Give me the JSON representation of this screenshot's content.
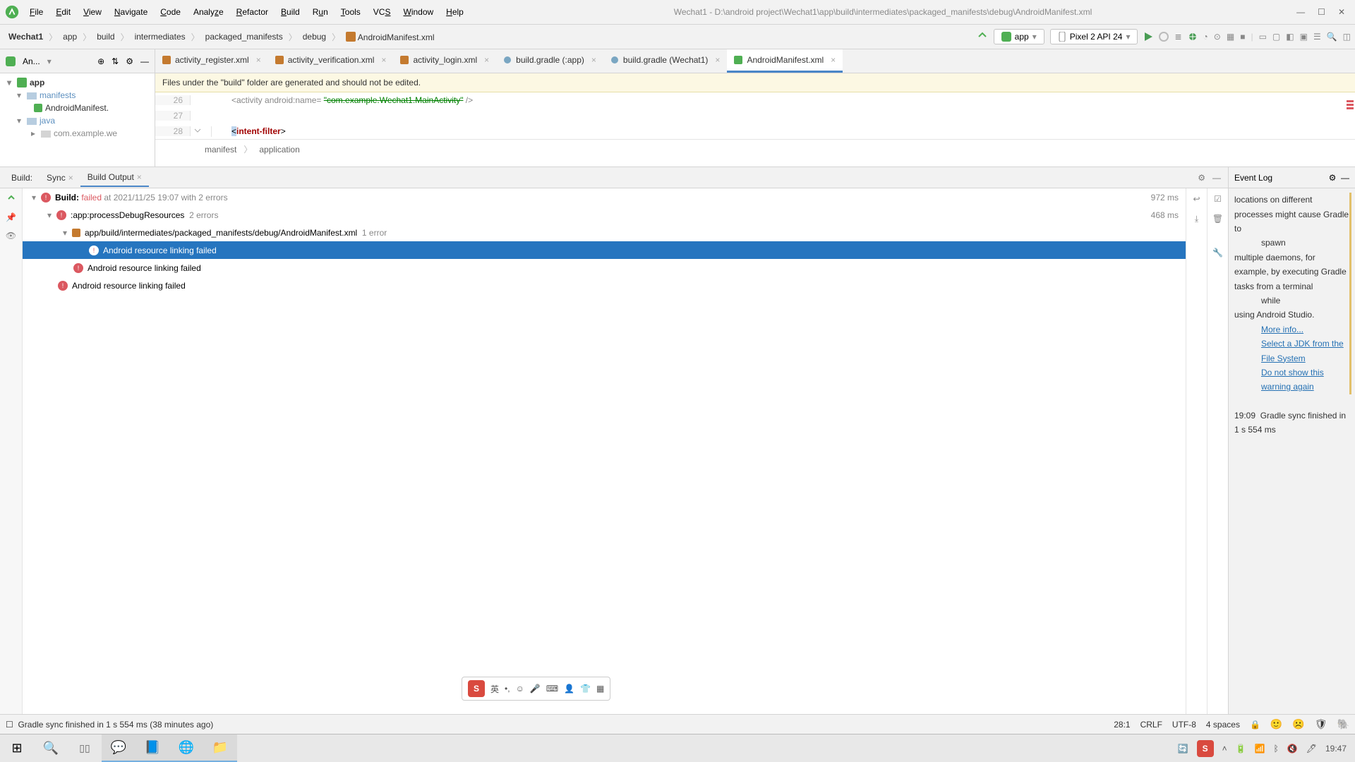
{
  "window": {
    "title": "Wechat1 - D:\\android project\\Wechat1\\app\\build\\intermediates\\packaged_manifests\\debug\\AndroidManifest.xml"
  },
  "menu": [
    "File",
    "Edit",
    "View",
    "Navigate",
    "Code",
    "Analyze",
    "Refactor",
    "Build",
    "Run",
    "Tools",
    "VCS",
    "Window",
    "Help"
  ],
  "breadcrumbs": [
    "Wechat1",
    "app",
    "build",
    "intermediates",
    "packaged_manifests",
    "debug",
    "AndroidManifest.xml"
  ],
  "run_config": {
    "module": "app",
    "device": "Pixel 2 API 24"
  },
  "project_tool": {
    "label": "An..."
  },
  "tree": {
    "root": "app",
    "manifests": "manifests",
    "manifest_file": "AndroidManifest.",
    "java": "java",
    "pkg": "com.example.we"
  },
  "tabs": [
    {
      "label": "activity_register.xml",
      "active": false
    },
    {
      "label": "activity_verification.xml",
      "active": false
    },
    {
      "label": "activity_login.xml",
      "active": false
    },
    {
      "label": "build.gradle (:app)",
      "active": false
    },
    {
      "label": "build.gradle (Wechat1)",
      "active": false
    },
    {
      "label": "AndroidManifest.xml",
      "active": true
    }
  ],
  "banner": "Files under the \"build\" folder are generated and should not be edited.",
  "code": {
    "l26": "26",
    "l27": "27",
    "l28": "28",
    "line26_a": "<activity ",
    "line26_attr": "android:name",
    "line26_eq": "= ",
    "line26_val": "\"com.example.Wechat1.MainActivity\"",
    "line26_end": "  />",
    "line28_a": "<",
    "line28_tag": "intent-filter",
    "line28_b": ">"
  },
  "crumb2": {
    "a": "manifest",
    "b": "application"
  },
  "panel": {
    "build": "Build:",
    "sync": "Sync",
    "output": "Build Output"
  },
  "build_tree": {
    "root_a": "Build:",
    "root_b": "failed",
    "root_c": "at 2021/11/25 19:07 with 2 errors",
    "root_t": "972 ms",
    "task": ":app:processDebugResources",
    "task_err": "2 errors",
    "task_t": "468 ms",
    "file": "app/build/intermediates/packaged_manifests/debug/AndroidManifest.xml",
    "file_err": "1 error",
    "msg1": "Android resource linking failed",
    "msg2": "Android resource linking failed",
    "msg3": "Android resource linking failed"
  },
  "eventlog": {
    "title": "Event Log",
    "body1": "locations on different processes might cause Gradle to",
    "body1b": "spawn",
    "body1c": "multiple daemons, for example, by executing Gradle tasks from a terminal",
    "body1d": "while",
    "body1e": "using Android Studio.",
    "link1": "More info...",
    "link2": "Select a JDK from the File System",
    "link3": "Do not show this warning again",
    "time": "19:09",
    "sync": "Gradle sync finished in 1 s 554 ms"
  },
  "status": {
    "msg": "Gradle sync finished in 1 s 554 ms (38 minutes ago)",
    "pos": "28:1",
    "eol": "CRLF",
    "enc": "UTF-8",
    "ind": "4 spaces"
  },
  "taskbar": {
    "time": "19:47"
  }
}
